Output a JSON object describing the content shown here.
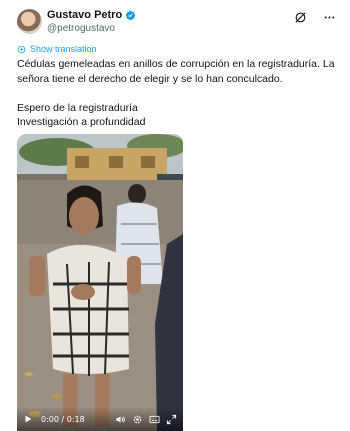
{
  "author": {
    "name": "Gustavo Petro",
    "handle": "@petrogustavo",
    "avatar_icon": "avatar",
    "verified_icon": "verified-badge-icon"
  },
  "header_actions": [
    "grok-icon",
    "more-icon"
  ],
  "translation": {
    "label": "Show translation",
    "icon": "translate-icon"
  },
  "tweet": {
    "lines": [
      "Cédulas gemeleadas en anillos de corrupción en la registraduría. La",
      "señora tiene el derecho de elegir y se lo han conculcado."
    ],
    "lines2": [
      "Espero de la registraduría",
      "Investigación a profundidad"
    ]
  },
  "video": {
    "time": "0:00 / 0:18",
    "controls": [
      "play-icon",
      "volume-icon",
      "settings-icon",
      "caption-icon",
      "fullscreen-icon"
    ]
  },
  "colors": {
    "accent": "#1d9bf0",
    "text": "#0f1419",
    "secondary": "#536471"
  }
}
